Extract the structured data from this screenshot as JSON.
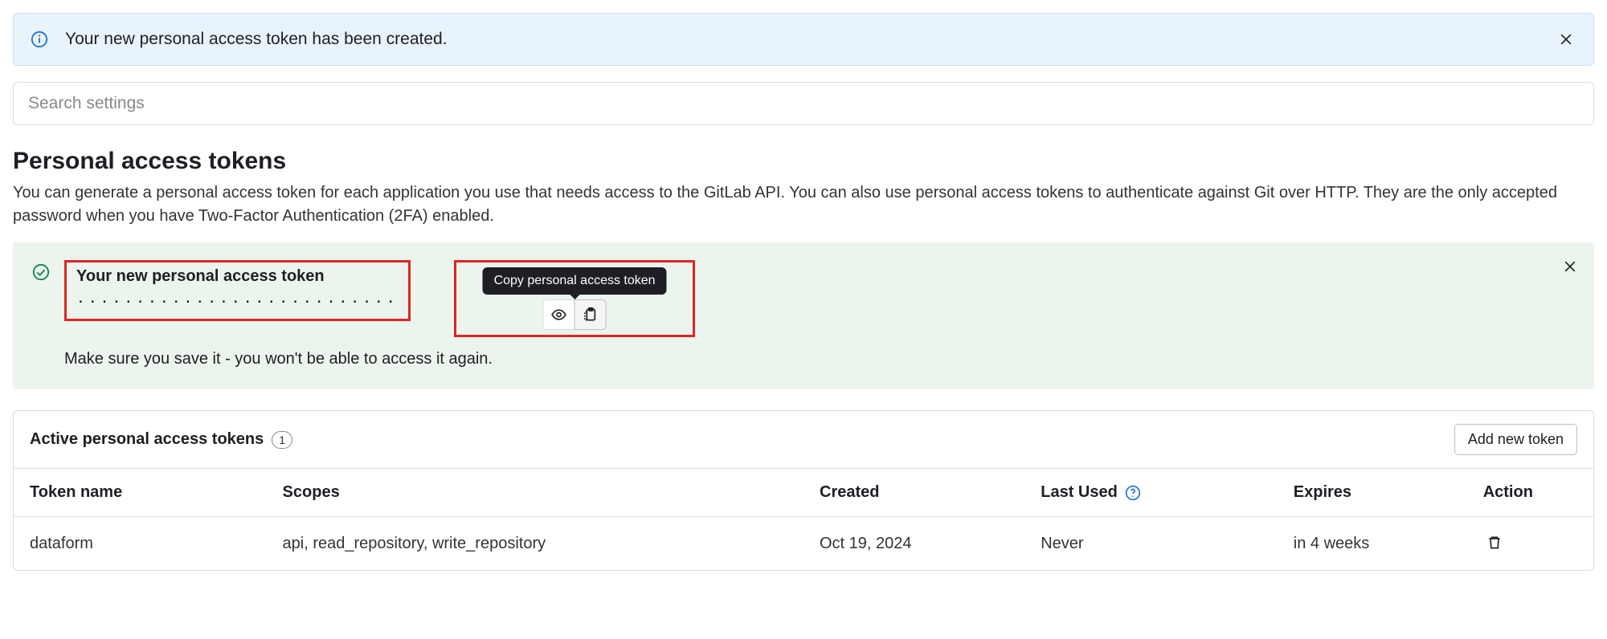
{
  "banner": {
    "message": "Your new personal access token has been created."
  },
  "search": {
    "placeholder": "Search settings"
  },
  "page": {
    "title": "Personal access tokens",
    "description": "You can generate a personal access token for each application you use that needs access to the GitLab API. You can also use personal access tokens to authenticate against Git over HTTP. They are the only accepted password when you have Two-Factor Authentication (2FA) enabled."
  },
  "new_token": {
    "heading": "Your new personal access token",
    "masked_value": "···························",
    "tooltip": "Copy personal access token",
    "warning": "Make sure you save it - you won't be able to access it again."
  },
  "tokens": {
    "section_title": "Active personal access tokens",
    "count": "1",
    "add_label": "Add new token",
    "columns": {
      "name": "Token name",
      "scopes": "Scopes",
      "created": "Created",
      "last_used": "Last Used",
      "expires": "Expires",
      "action": "Action"
    },
    "rows": [
      {
        "name": "dataform",
        "scopes": "api, read_repository, write_repository",
        "created": "Oct 19, 2024",
        "last_used": "Never",
        "expires": "in 4 weeks"
      }
    ]
  }
}
